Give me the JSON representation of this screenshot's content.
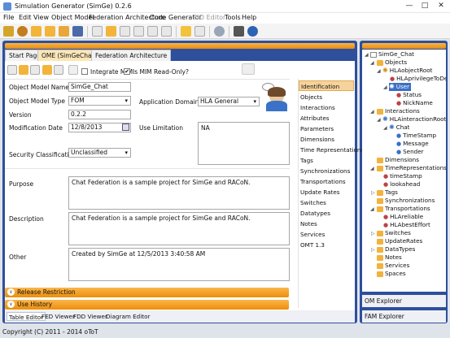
{
  "window": {
    "title": "Simulation Generator (SimGe) 0.2.6"
  },
  "menu": [
    "File",
    "Edit",
    "View",
    "Object Model",
    "Federation Architecture",
    "Code Generator",
    "RID Editor",
    "Tools",
    "Help"
  ],
  "tabs": {
    "start": "Start Page",
    "ome": "OME (SimGeChat)",
    "ome_close": "✕",
    "fed": "Federation Architecture"
  },
  "editor_toolbar": {
    "integrate_label": "Integrate MIM",
    "readonly_label": "Is MIM Read-Only?",
    "readonly_checked": "✔"
  },
  "form": {
    "name_label": "Object Model Name",
    "name_value": "SimGe_Chat",
    "type_label": "Object Model Type",
    "type_value": "FOM",
    "domain_label": "Application Domain",
    "domain_value": "HLA General",
    "version_label": "Version",
    "version_value": "0.2.2",
    "moddate_label": "Modification Date",
    "moddate_value": "12/8/2013",
    "uselimit_label": "Use Limitation",
    "uselimit_value": "NA",
    "security_label": "Security Classification",
    "security_value": "Unclassified",
    "purpose_label": "Purpose",
    "purpose_value": "Chat Federation is a sample project for SimGe and RACoN.",
    "description_label": "Description",
    "description_value": "Chat Federation is a sample project for SimGe and RACoN.",
    "other_label": "Other",
    "other_value": "Created by SimGe at 12/5/2013 3:40:58 AM"
  },
  "side_list": [
    "Identification",
    "Objects",
    "Interactions",
    "Attributes",
    "Parameters",
    "Dimensions",
    "Time Representations",
    "Tags",
    "Synchronizations",
    "Transportations",
    "Update Rates",
    "Switches",
    "Datatypes",
    "Notes",
    "Services",
    "OMT 1.3"
  ],
  "sections": {
    "release": "Release Restriction",
    "history": "Use History"
  },
  "bottom_tabs": [
    "Table Editor",
    "FED Viewer",
    "FDD Viewer",
    "Diagram Editor"
  ],
  "tree": {
    "root": "SimGe_Chat",
    "objects": "Objects",
    "hla_object_root": "HLAobjectRoot",
    "hla_privilege": "HLAprivilegeToDe",
    "user": "User",
    "status": "Status",
    "nickname": "NickName",
    "interactions": "Interactions",
    "hla_interaction_root": "HLAinteractionRoot",
    "chat": "Chat",
    "timestamp": "TimeStamp",
    "message": "Message",
    "sender": "Sender",
    "dimensions": "Dimensions",
    "time_reps": "TimeRepresentations",
    "timestamp2": "timeStamp",
    "lookahead": "lookahead",
    "tags": "Tags",
    "syncs": "Synchronizations",
    "transports": "Transportations",
    "hla_reliable": "HLAreliable",
    "hla_besteffort": "HLAbestEffort",
    "switches": "Switches",
    "update_rates": "UpdateRates",
    "datatypes": "DataTypes",
    "notes": "Notes",
    "services": "Services",
    "spaces": "Spaces"
  },
  "right_tabs": {
    "om_explorer": "OM Explorer",
    "fam_explorer": "FAM Explorer"
  },
  "status": "Copyright (C) 2011 - 2014 oToT",
  "colors": {
    "frame": "#2d4f9c",
    "accent_orange": "#ec8e0c",
    "selection": "#f6d39b"
  }
}
